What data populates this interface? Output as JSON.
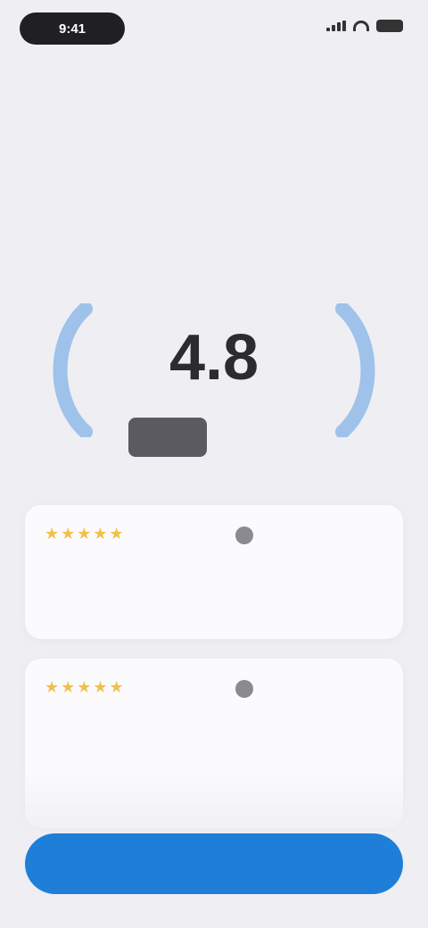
{
  "status_bar": {
    "time": "9:41",
    "icons": [
      "signal-icon",
      "wifi-icon",
      "battery-icon"
    ]
  },
  "header": {
    "subtitle": "",
    "headline": ""
  },
  "rating": {
    "value": "4.8",
    "caption": "",
    "badge": "",
    "laurel_color": "#9ec2ea"
  },
  "reviews": [
    {
      "stars": "★★★★★",
      "date": "",
      "title": "",
      "body": ""
    },
    {
      "stars": "★★★★★",
      "date": "",
      "title": "",
      "body": ""
    }
  ],
  "cta": {
    "label": "",
    "color": "#1f7fd8"
  },
  "footer": {
    "left_link": "",
    "right_link": ""
  }
}
